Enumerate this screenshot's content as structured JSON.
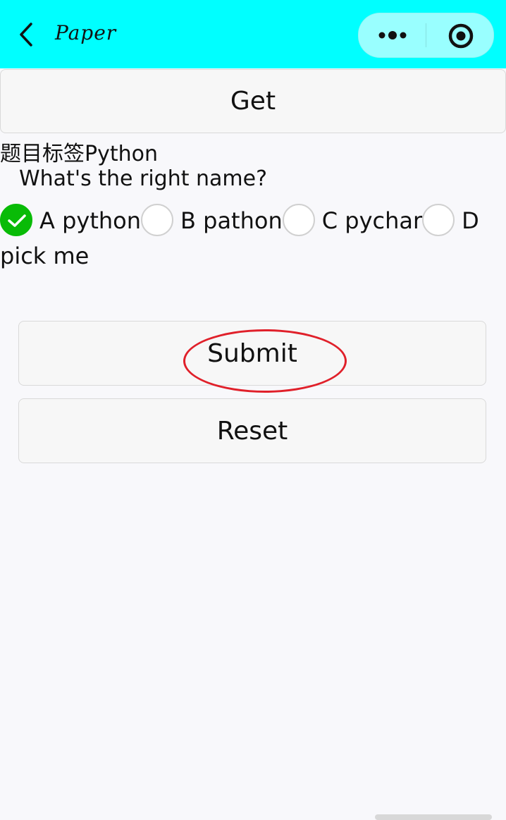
{
  "navbar": {
    "title": "Paper",
    "background": "#00ffff",
    "back_icon": "chevron-left-icon",
    "more_icon": "more-dots-icon",
    "close_icon": "target-circle-icon"
  },
  "actions": {
    "get_label": "Get",
    "submit_label": "Submit",
    "reset_label": "Reset"
  },
  "question": {
    "tag_line": "题目标签Python",
    "text": "What's the right name?",
    "options": [
      {
        "label": "A python",
        "checked": true
      },
      {
        "label": "B pathon",
        "checked": false
      },
      {
        "label": "C pychar",
        "checked": false
      },
      {
        "label": "D pick me",
        "checked": false
      }
    ],
    "checked_color": "#09bb07"
  },
  "annotation": {
    "color": "#e0202a",
    "shape": "ellipse"
  }
}
